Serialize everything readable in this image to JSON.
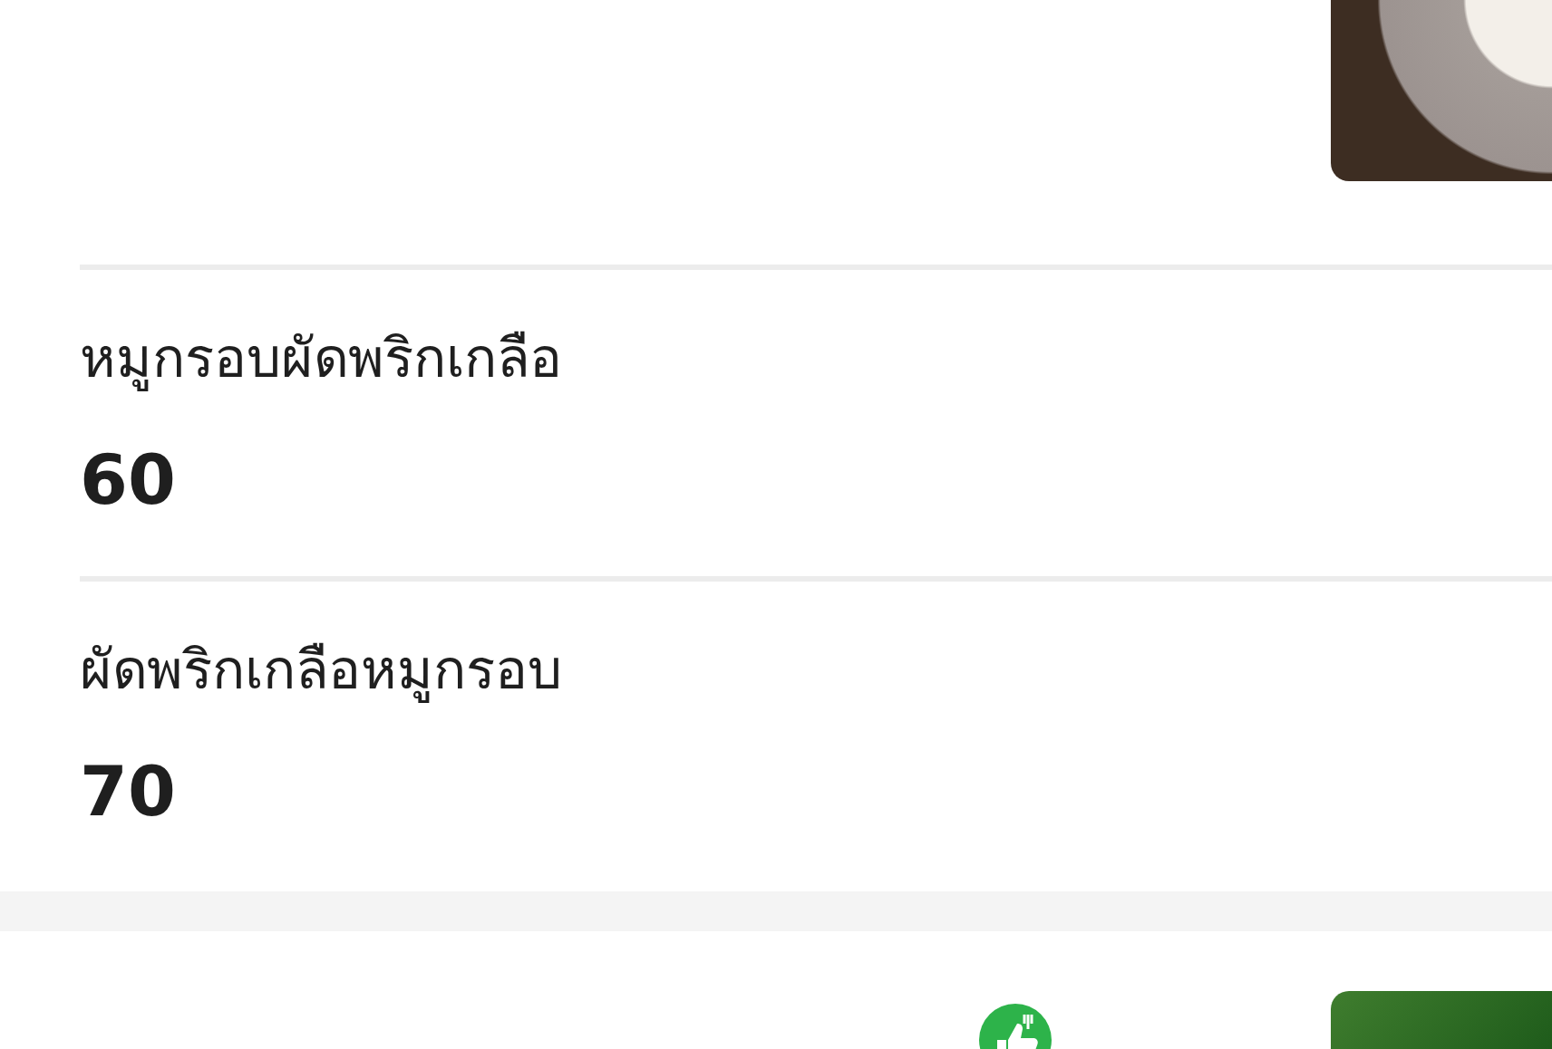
{
  "menu_items": [
    {
      "name": "หมูกรอบผัดพริกเกลือ",
      "price": "60"
    },
    {
      "name": "ผัดพริกเกลือหมูกรอบ",
      "price": "70"
    }
  ]
}
